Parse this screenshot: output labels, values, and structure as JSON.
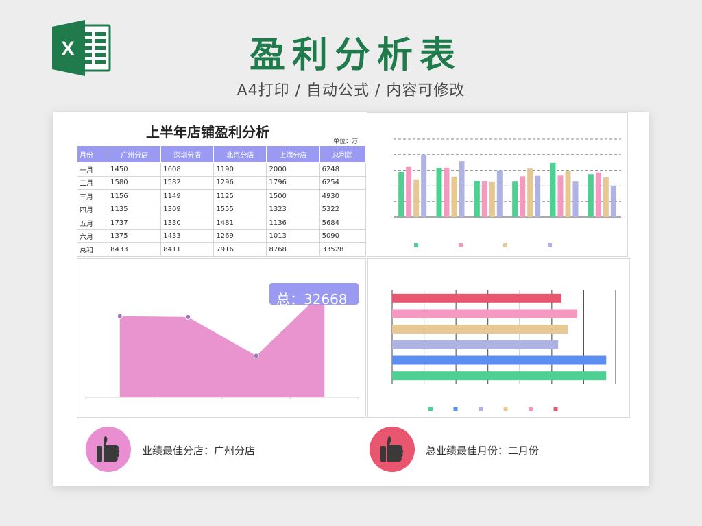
{
  "header": {
    "logo_letter": "X",
    "title": "盈利分析表",
    "subtitle": "A4打印 / 自动公式 / 内容可修改"
  },
  "table": {
    "title": "上半年店铺盈利分析",
    "unit": "单位：万",
    "columns": [
      "月份",
      "广州分店",
      "深圳分店",
      "北京分店",
      "上海分店",
      "总利润"
    ],
    "rows": [
      [
        "一月",
        "1450",
        "1608",
        "1190",
        "2000",
        "6248"
      ],
      [
        "二月",
        "1580",
        "1582",
        "1296",
        "1796",
        "6254"
      ],
      [
        "三月",
        "1156",
        "1149",
        "1125",
        "1500",
        "4930"
      ],
      [
        "四月",
        "1135",
        "1309",
        "1555",
        "1323",
        "5322"
      ],
      [
        "五月",
        "1737",
        "1330",
        "1481",
        "1136",
        "5684"
      ],
      [
        "六月",
        "1375",
        "1433",
        "1269",
        "1013",
        "5090"
      ],
      [
        "总和",
        "8433",
        "8411",
        "7916",
        "8768",
        "33528"
      ]
    ]
  },
  "callout": {
    "text": "总：32668"
  },
  "footer": {
    "best_store": "业绩最佳分店：广州分店",
    "best_month": "总业绩最佳月份：二月份"
  },
  "colors": {
    "brand_green": "#1f7a4c",
    "green": "#4dd092",
    "pink": "#f49ac1",
    "tan": "#e7c892",
    "lavender": "#aeb3e3",
    "blue": "#5b8ef0",
    "red": "#e8566f",
    "area_pink": "#e994cf",
    "header_purple": "#9a9af3",
    "thumb_pink": "#e98ed0",
    "thumb_red": "#e8566f"
  },
  "chart_data": [
    {
      "type": "bar",
      "categories": [
        "",
        "",
        "",
        "",
        "",
        ""
      ],
      "series": [
        {
          "values": [
            1450,
            1580,
            1156,
            1135,
            1737,
            1375
          ]
        },
        {
          "values": [
            1608,
            1582,
            1149,
            1309,
            1330,
            1433
          ]
        },
        {
          "values": [
            1190,
            1296,
            1125,
            1555,
            1481,
            1269
          ]
        },
        {
          "values": [
            2000,
            1796,
            1500,
            1323,
            1136,
            1013
          ]
        }
      ],
      "ylim": [
        0,
        2500
      ],
      "grid": true,
      "legend": "bottom"
    },
    {
      "type": "area",
      "x": [
        "",
        "",
        "",
        ""
      ],
      "values": [
        1950,
        1930,
        1000,
        2580
      ],
      "ylim": [
        0,
        3000
      ],
      "grid": false
    },
    {
      "type": "bar",
      "orientation": "horizontal",
      "categories": [
        "",
        "",
        "",
        "",
        "",
        ""
      ],
      "values": [
        33528,
        33528,
        26000,
        27500,
        29000,
        26500
      ],
      "xlim": [
        0,
        35000
      ],
      "grid": true,
      "legend": "bottom"
    }
  ]
}
